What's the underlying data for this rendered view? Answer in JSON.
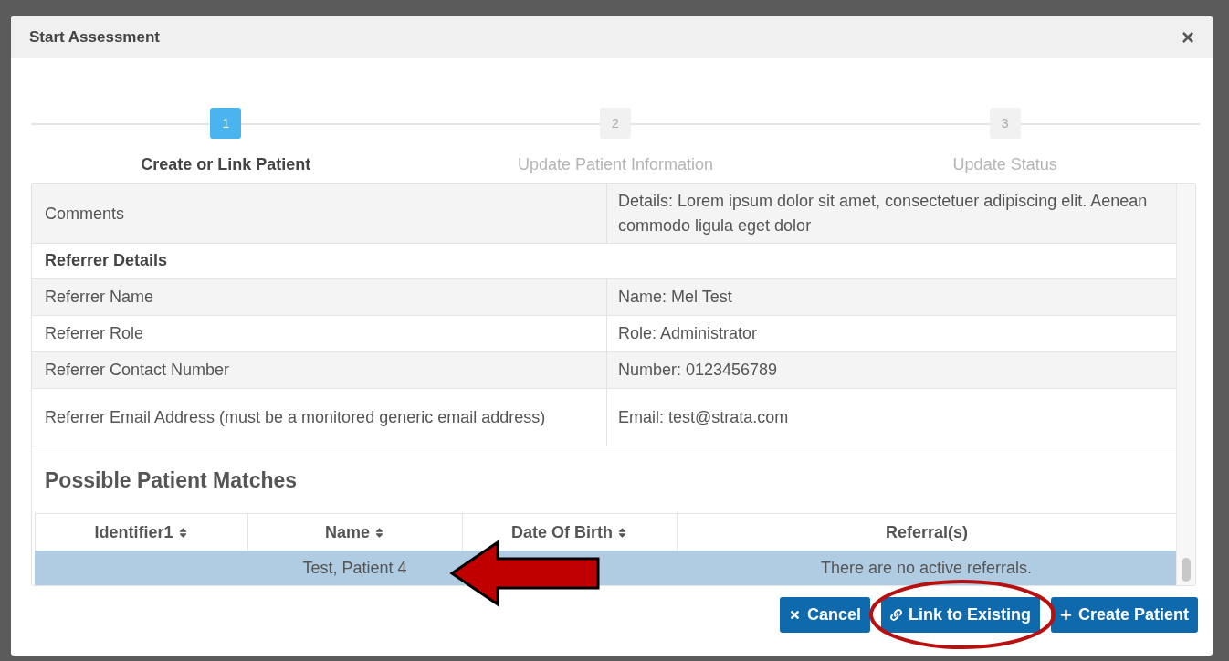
{
  "dialog": {
    "title": "Start Assessment",
    "close": "×"
  },
  "steps": [
    {
      "number": "1",
      "label": "Create or Link Patient",
      "selected": true
    },
    {
      "number": "2",
      "label": "Update Patient Information",
      "selected": false
    },
    {
      "number": "3",
      "label": "Update Status",
      "selected": false
    }
  ],
  "details": [
    {
      "kind": "row",
      "label": "Comments",
      "value": "Details: Lorem ipsum dolor sit amet, consectetuer adipiscing elit. Aenean commodo ligula eget dolor"
    },
    {
      "kind": "section",
      "label": "Referrer Details"
    },
    {
      "kind": "row",
      "label": "Referrer Name",
      "value": "Name: Mel Test"
    },
    {
      "kind": "row",
      "label": "Referrer Role",
      "value": "Role: Administrator"
    },
    {
      "kind": "row",
      "label": "Referrer Contact Number",
      "value": "Number: 0123456789"
    },
    {
      "kind": "row",
      "label": "Referrer Email Address (must be a monitored generic email address)",
      "value": "Email: test@strata.com"
    }
  ],
  "matches": {
    "title": "Possible Patient Matches",
    "columns": [
      {
        "label": "Identifier1",
        "sortable": true
      },
      {
        "label": "Name",
        "sortable": true
      },
      {
        "label": "Date Of Birth",
        "sortable": true
      },
      {
        "label": "Referral(s)",
        "sortable": false
      }
    ],
    "rows": [
      {
        "cells": [
          "",
          "Test, Patient 4",
          "",
          "There are no active referrals."
        ],
        "selected": true
      }
    ]
  },
  "buttons": [
    {
      "label": "Cancel"
    },
    {
      "label": "Link to Existing"
    },
    {
      "label": "Create Patient"
    }
  ]
}
